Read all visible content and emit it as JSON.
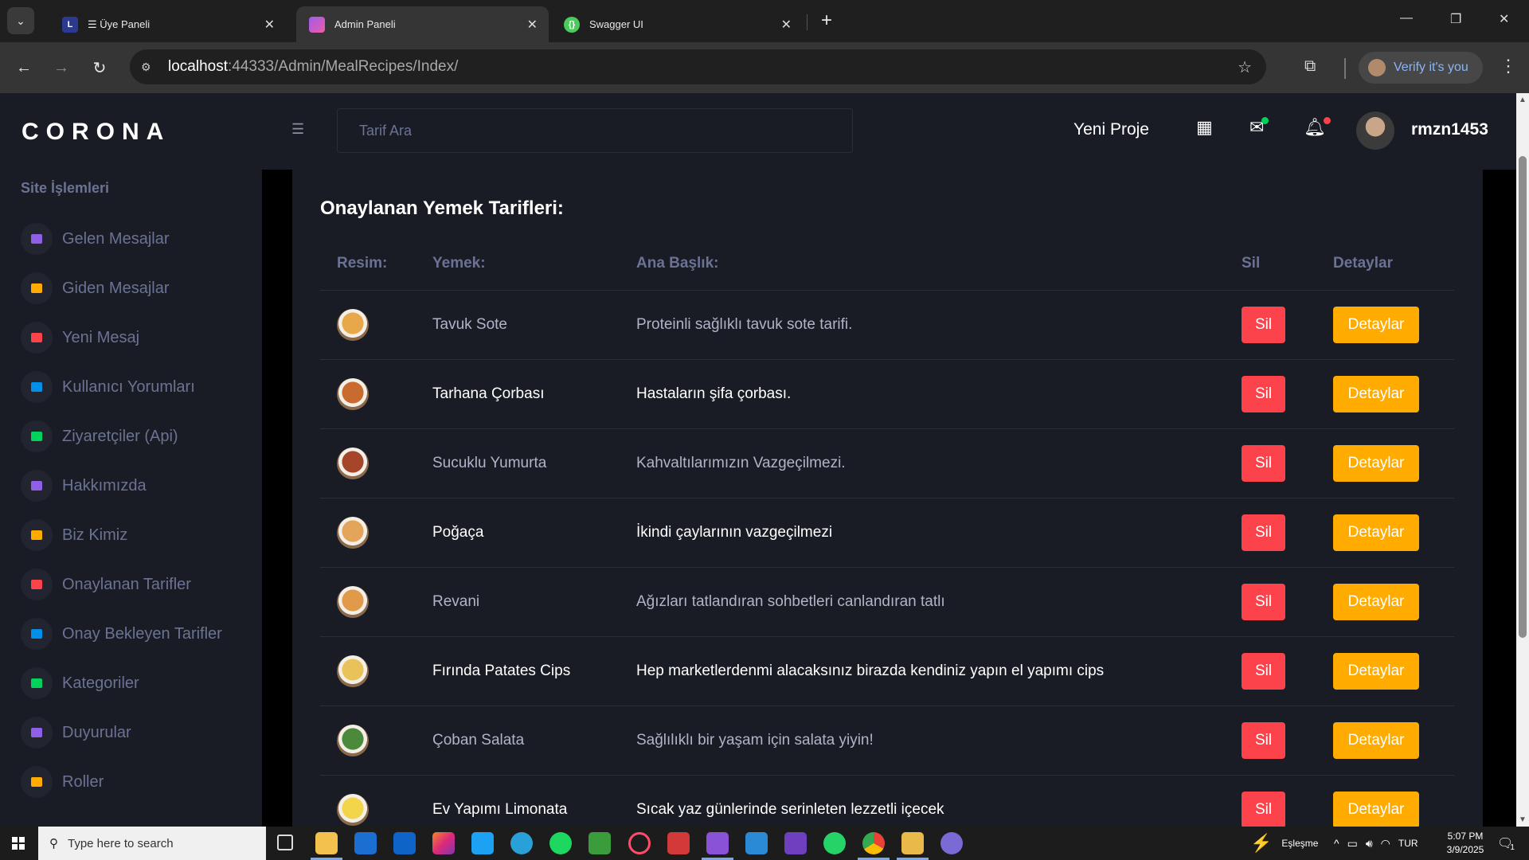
{
  "browser": {
    "tabs": [
      {
        "title": "☰ Üye Paneli",
        "close": "✕"
      },
      {
        "title": "Admin Paneli",
        "close": "✕"
      },
      {
        "title": "Swagger UI",
        "close": "✕"
      }
    ],
    "new_tab": "+",
    "url_host": "localhost",
    "url_path": ":44333/Admin/MealRecipes/Index/",
    "verify_label": "Verify it's you"
  },
  "sidebar": {
    "brand": "CORONA",
    "heading": "Site İşlemleri",
    "items": [
      {
        "label": "Gelen Mesajlar",
        "color": "#8f5fe8"
      },
      {
        "label": "Giden Mesajlar",
        "color": "#ffab00"
      },
      {
        "label": "Yeni Mesaj",
        "color": "#fc424a"
      },
      {
        "label": "Kullanıcı Yorumları",
        "color": "#0090e7"
      },
      {
        "label": "Ziyaretçiler (Api)",
        "color": "#00d25b"
      },
      {
        "label": "Hakkımızda",
        "color": "#8f5fe8"
      },
      {
        "label": "Biz Kimiz",
        "color": "#ffab00"
      },
      {
        "label": "Onaylanan Tarifler",
        "color": "#fc424a"
      },
      {
        "label": "Onay Bekleyen Tarifler",
        "color": "#0090e7"
      },
      {
        "label": "Kategoriler",
        "color": "#00d25b"
      },
      {
        "label": "Duyurular",
        "color": "#8f5fe8"
      },
      {
        "label": "Roller",
        "color": "#ffab00"
      }
    ]
  },
  "navbar": {
    "search_placeholder": "Tarif Ara",
    "new_project": "Yeni Proje",
    "username": "rmzn1453"
  },
  "main": {
    "title": "Onaylanan Yemek Tarifleri:",
    "columns": [
      "Resim:",
      "Yemek:",
      "Ana Başlık:",
      "Sil",
      "Detaylar"
    ],
    "rows": [
      {
        "name": "Tavuk Sote",
        "headline": "Proteinli sağlıklı tavuk sote tarifi.",
        "delete": "Sil",
        "details": "Detaylar"
      },
      {
        "name": "Tarhana Çorbası",
        "headline": "Hastaların şifa çorbası.",
        "delete": "Sil",
        "details": "Detaylar"
      },
      {
        "name": "Sucuklu Yumurta",
        "headline": "Kahvaltılarımızın Vazgeçilmezi.",
        "delete": "Sil",
        "details": "Detaylar"
      },
      {
        "name": "Poğaça",
        "headline": "İkindi çaylarının vazgeçilmezi",
        "delete": "Sil",
        "details": "Detaylar"
      },
      {
        "name": "Revani",
        "headline": "Ağızları tatlandıran sohbetleri canlandıran tatlı",
        "delete": "Sil",
        "details": "Detaylar"
      },
      {
        "name": "Fırında Patates Cips",
        "headline": "Hep marketlerdenmi alacaksınız birazda kendiniz yapın el yapımı cips",
        "delete": "Sil",
        "details": "Detaylar"
      },
      {
        "name": "Çoban Salata",
        "headline": "Sağlılıklı bir yaşam için salata yiyin!",
        "delete": "Sil",
        "details": "Detaylar"
      },
      {
        "name": "Ev Yapımı Limonata",
        "headline": "Sıcak yaz günlerinde serinleten lezzetli içecek",
        "delete": "Sil",
        "details": "Detaylar"
      }
    ]
  },
  "taskbar": {
    "search_placeholder": "Type here to search",
    "weather_label": "Eşleşme",
    "lang": "TUR",
    "time": "5:07 PM",
    "date": "3/9/2025",
    "notif_count": "1"
  }
}
